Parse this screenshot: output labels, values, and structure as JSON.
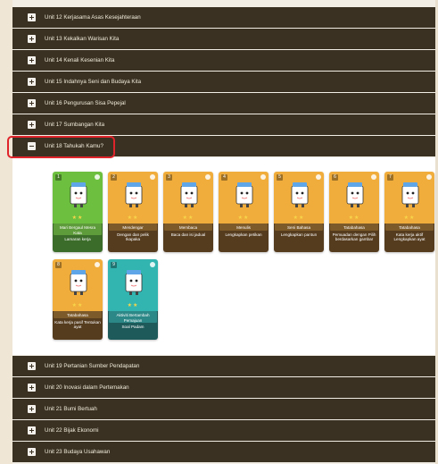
{
  "units_before": [
    {
      "label": "Unit 12 Kerjasama Asas Kesejahteraan"
    },
    {
      "label": "Unit 13 Kekalkan Warisan Kita"
    },
    {
      "label": "Unit 14 Kenali Kesenian Kita"
    },
    {
      "label": "Unit 15 Indahnya Seni dan Budaya Kita"
    },
    {
      "label": "Unit 16 Pengurusan Sisa Pepejal"
    },
    {
      "label": "Unit 17 Sumbangan Kita"
    }
  ],
  "expanded_unit": {
    "label": "Unit 18 Tahukah Kamu?",
    "cards": [
      {
        "number": "1",
        "title": "Mari Bergaul Mesra Kata",
        "subtitle": "Lamaran kerja",
        "theme": "green",
        "stars": "★★"
      },
      {
        "number": "2",
        "title": "Mendengar",
        "subtitle": "Dengan dan pelik Ikapaka",
        "theme": "orange",
        "stars": "★★"
      },
      {
        "number": "3",
        "title": "Membaca",
        "subtitle": "Baca dan isi jadual",
        "theme": "orange",
        "stars": "★★"
      },
      {
        "number": "4",
        "title": "Menulis",
        "subtitle": "Lengkapkan petikan",
        "theme": "orange",
        "stars": "★★"
      },
      {
        "number": "5",
        "title": "Seni Bahasa",
        "subtitle": "Lengkapkan pantun",
        "theme": "orange",
        "stars": "★★"
      },
      {
        "number": "6",
        "title": "Tatabahasa",
        "subtitle": "Pemuadan dengan Pilih berdasarkan gambar",
        "theme": "orange",
        "stars": "★★"
      },
      {
        "number": "7",
        "title": "Tatabahasa",
        "subtitle": "Kata kerja aktif Lengkapkan ayat",
        "theme": "orange",
        "stars": "★★"
      },
      {
        "number": "8",
        "title": "Tatabahasa",
        "subtitle": "Kata kerja pasif Tentukan ayat",
        "theme": "orange",
        "stars": "★★"
      },
      {
        "number": "9",
        "title": "Aktiviti Bertambah Pemajuan",
        "subtitle": "Soal Padam",
        "theme": "teal",
        "stars": "★★"
      }
    ]
  },
  "units_after": [
    {
      "label": "Unit 19 Pertanian Sumber Pendapatan"
    },
    {
      "label": "Unit 20 Inovasi dalam Pertemakan"
    },
    {
      "label": "Unit 21 Bumi Bertuah"
    },
    {
      "label": "Unit 22 Bijak Ekonomi"
    },
    {
      "label": "Unit 23 Budaya Usahawan"
    }
  ],
  "colors": {
    "row_bg": "#3a3123",
    "highlight": "#e0242b",
    "card_orange": "#f0ad3c",
    "card_green": "#6cbf3f",
    "card_teal": "#32b4b1"
  }
}
